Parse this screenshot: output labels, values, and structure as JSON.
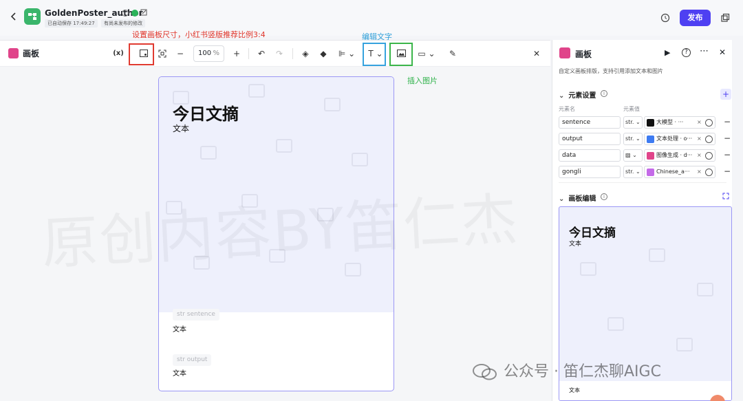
{
  "header": {
    "app_name": "GoldenPoster_author",
    "autosave": "已自动保存 17:49:27",
    "unpublished": "有尚未发布的修改",
    "publish_label": "发布"
  },
  "annotations": {
    "size_hint": "设置画板尺寸，小红书竖版推荐比例3:4",
    "edit_text": "编辑文字",
    "insert_image": "插入图片"
  },
  "toolbar": {
    "title": "画板",
    "variable_label": "(x)",
    "zoom_value": "100",
    "zoom_unit": "%"
  },
  "poster": {
    "title": "今日文摘",
    "subtitle": "文本",
    "tag1": "str sentence",
    "text1": "文本",
    "tag2": "str output",
    "text2": "文本"
  },
  "sidebar": {
    "title": "画板",
    "description": "自定义画板排版，支持引用添加文本和图片",
    "element_settings": "元素设置",
    "col_name": "元素名",
    "col_value": "元素值",
    "rows": [
      {
        "name": "sentence",
        "type": "str.",
        "value": "大模型 · ···",
        "icon_color": "#111111"
      },
      {
        "name": "output",
        "type": "str.",
        "value": "文本处理 · o···",
        "icon_color": "#3d7bf2"
      },
      {
        "name": "data",
        "type": "",
        "value": "图像生成 · d···",
        "icon_color": "#e0448a"
      },
      {
        "name": "gongli",
        "type": "str.",
        "value": "Chinese_a···",
        "icon_color": "#c46ae8"
      }
    ],
    "canvas_edit": "画板编辑",
    "preview_title": "今日文摘",
    "preview_sub": "文本",
    "preview_text": "文本"
  },
  "watermark": {
    "big": "原创内容BY笛仁杰",
    "credit": "公众号 · 笛仁杰聊AIGC"
  }
}
